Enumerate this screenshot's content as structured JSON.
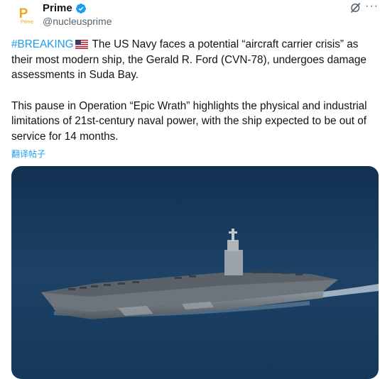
{
  "author": {
    "name": "Prime",
    "handle": "@nucleusprime",
    "avatar_text": "P",
    "avatar_subtext": "Prime",
    "verified_color": "#1d9bf0"
  },
  "header_icons": [
    "grok-icon",
    "more-options-icon"
  ],
  "more_label": "···",
  "tweet": {
    "hashtag": "#BREAKING",
    "flag": "us-flag-icon",
    "paragraph1_rest": " The US Navy faces a potential “aircraft carrier crisis” as their most modern ship, the Gerald R. Ford (CVN-78), undergoes damage assessments in Suda Bay.",
    "paragraph2": "This pause in Operation “Epic Wrath” highlights the physical and industrial limitations of 21st-century naval power, with the ship expected to be out of service for 14 months."
  },
  "translate_label": "翻译帖子",
  "media": {
    "type": "photo",
    "subject": "aircraft-carrier-at-sea"
  },
  "colors": {
    "link": "#1d9bf0",
    "secondary_text": "#536471",
    "sea": "#1d3d5c"
  }
}
